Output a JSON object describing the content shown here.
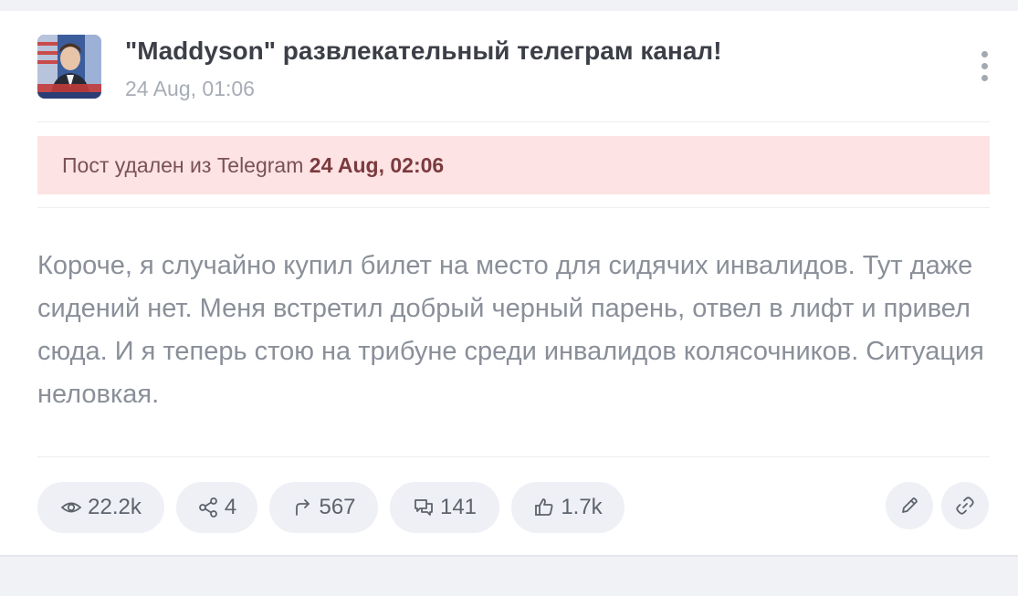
{
  "post": {
    "channel_name": "\"Maddyson\" развлекательный телеграм канал!",
    "date": "24 Aug, 01:06",
    "deleted_notice": {
      "prefix": "Пост удален из Telegram",
      "date": "24 Aug, 02:06"
    },
    "text": "Короче, я случайно купил билет на место для сидячих инвалидов. Тут даже сидений нет. Меня встретил добрый черный парень, отвел в лифт и привел сюда. И я теперь стою на трибуне среди инвалидов колясочников. Ситуация неловкая."
  },
  "stats": {
    "views": "22.2k",
    "shares": "4",
    "forwards": "567",
    "comments": "141",
    "reactions": "1.7k"
  },
  "icons": {
    "views": "eye-icon",
    "shares": "share-nodes-icon",
    "forwards": "forward-arrow-icon",
    "comments": "comments-icon",
    "reactions": "thumbs-up-icon",
    "edit": "pencil-icon",
    "link": "link-icon",
    "menu": "kebab-menu-icon"
  },
  "colors": {
    "banner_bg": "#fde3e3",
    "banner_text": "#7b3a3e",
    "pill_bg": "#eef0f5"
  }
}
